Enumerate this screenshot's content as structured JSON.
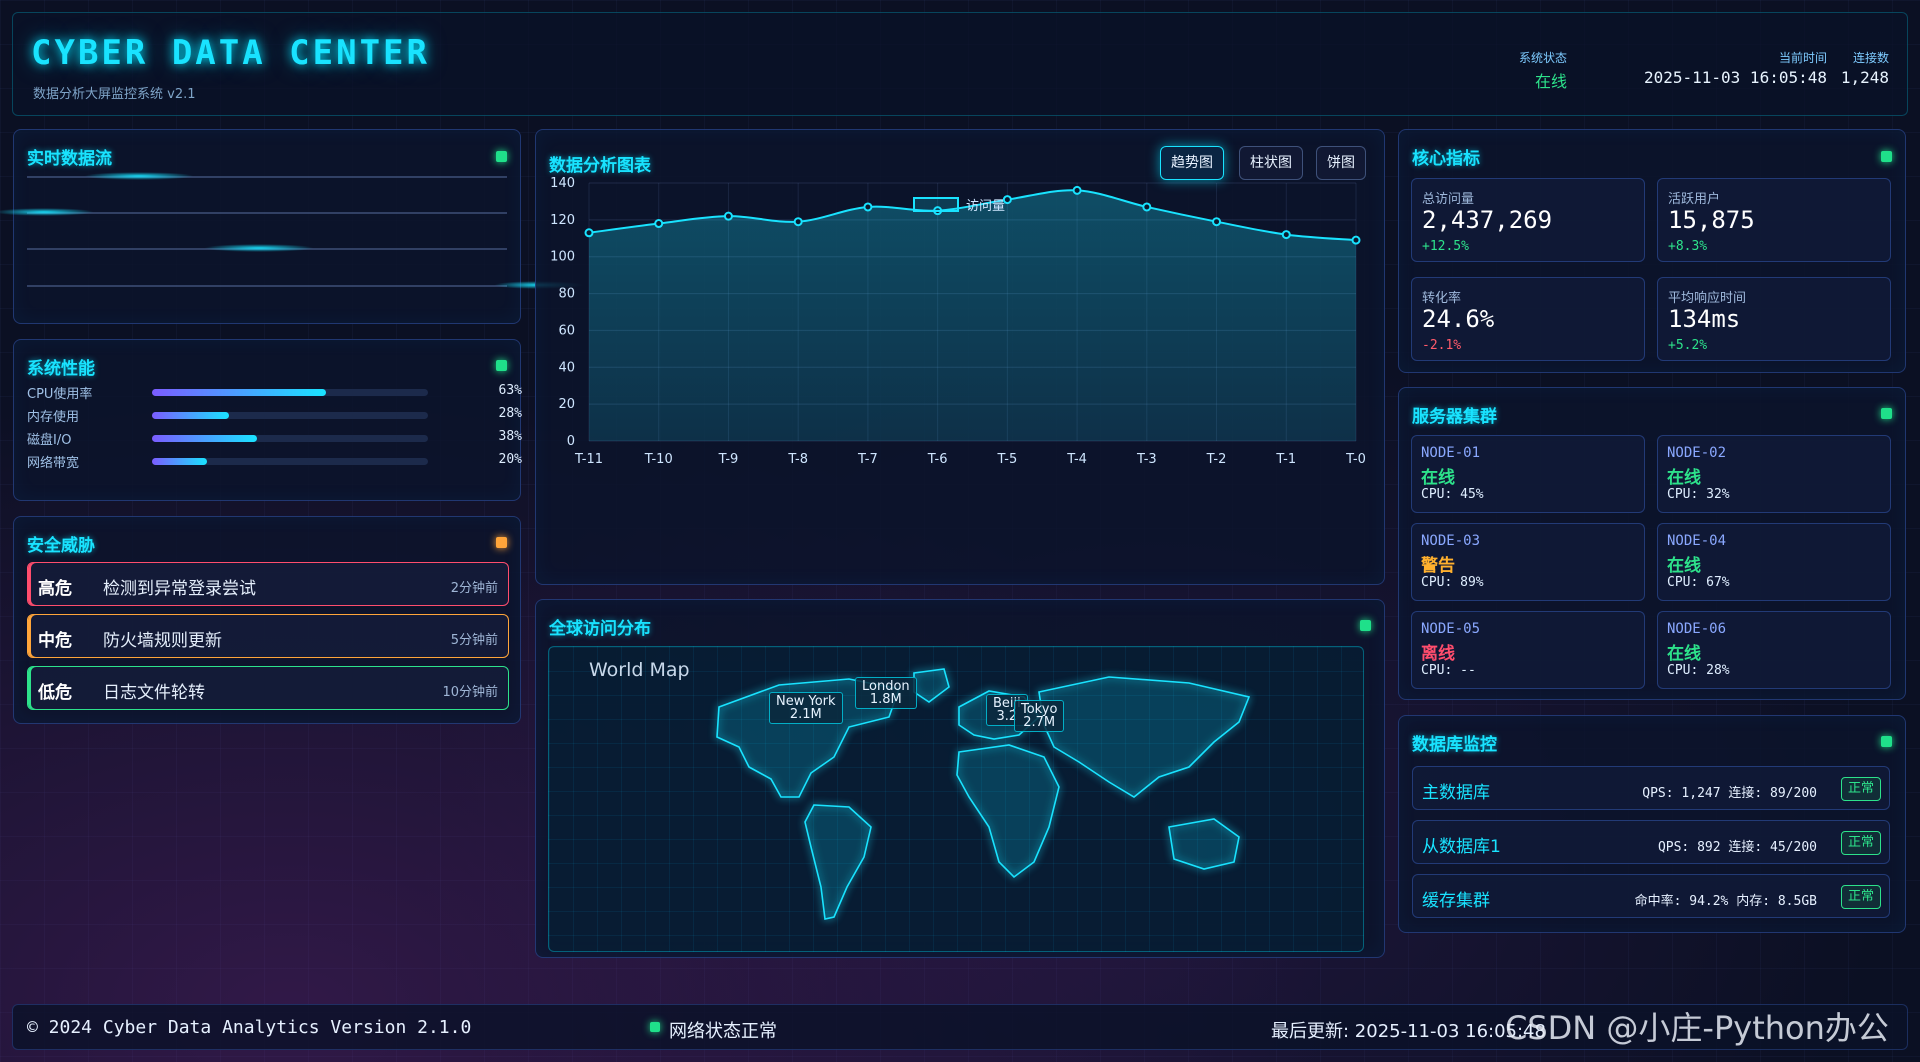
{
  "header": {
    "title": "CYBER DATA CENTER",
    "subtitle": "数据分析大屏监控系统 v2.1",
    "status_label": "系统状态",
    "status_value": "在线",
    "time_label": "当前时间",
    "time_value": "2025-11-03 16:05:48",
    "conn_label": "连接数",
    "conn_value": "1,248"
  },
  "realtime": {
    "title": "实时数据流"
  },
  "performance": {
    "title": "系统性能",
    "items": [
      {
        "label": "CPU使用率",
        "pct_text": "63%",
        "value": 63
      },
      {
        "label": "内存使用",
        "pct_text": "28%",
        "value": 28
      },
      {
        "label": "磁盘I/O",
        "pct_text": "38%",
        "value": 38
      },
      {
        "label": "网络带宽",
        "pct_text": "20%",
        "value": 20
      }
    ]
  },
  "threats": {
    "title": "安全威胁",
    "items": [
      {
        "level": "高危",
        "message": "检测到异常登录尝试",
        "time": "2分钟前",
        "color": "#ff4d6d"
      },
      {
        "level": "中危",
        "message": "防火墙规则更新",
        "time": "5分钟前",
        "color": "#ffa53a"
      },
      {
        "level": "低危",
        "message": "日志文件轮转",
        "time": "10分钟前",
        "color": "#2de28b"
      }
    ]
  },
  "chart_panel": {
    "title": "数据分析图表",
    "tabs": [
      "趋势图",
      "柱状图",
      "饼图"
    ],
    "active_tab": 0
  },
  "chart_data": {
    "type": "area",
    "categories": [
      "T-11",
      "T-10",
      "T-9",
      "T-8",
      "T-7",
      "T-6",
      "T-5",
      "T-4",
      "T-3",
      "T-2",
      "T-1",
      "T-0"
    ],
    "series": [
      {
        "name": "访问量",
        "values": [
          113,
          118,
          122,
          119,
          127,
          125,
          131,
          136,
          127,
          119,
          112,
          109
        ],
        "color": "#19e3ff"
      }
    ],
    "yticks": [
      0,
      20,
      40,
      60,
      80,
      100,
      120,
      140
    ],
    "ylim": [
      0,
      140
    ],
    "grid": true,
    "legend": "top-center"
  },
  "map_panel": {
    "title": "全球访问分布",
    "alt_text": "World Map",
    "cities": [
      {
        "name": "New York",
        "value": "2.1M"
      },
      {
        "name": "London",
        "value": "1.8M"
      },
      {
        "name": "Beiji",
        "value": "3.2"
      },
      {
        "name": "Tokyo",
        "value": "2.7M"
      }
    ]
  },
  "kpi": {
    "title": "核心指标",
    "items": [
      {
        "label": "总访问量",
        "value": "2,437,269",
        "change": "+12.5%",
        "dir": "up"
      },
      {
        "label": "活跃用户",
        "value": "15,875",
        "change": "+8.3%",
        "dir": "up"
      },
      {
        "label": "转化率",
        "value": "24.6%",
        "change": "-2.1%",
        "dir": "down"
      },
      {
        "label": "平均响应时间",
        "value": "134ms",
        "change": "+5.2%",
        "dir": "up"
      }
    ]
  },
  "cluster": {
    "title": "服务器集群",
    "nodes": [
      {
        "id": "NODE-01",
        "status": "在线",
        "state": "on",
        "cpu": "CPU: 45%"
      },
      {
        "id": "NODE-02",
        "status": "在线",
        "state": "on",
        "cpu": "CPU: 32%"
      },
      {
        "id": "NODE-03",
        "status": "警告",
        "state": "warn",
        "cpu": "CPU: 89%"
      },
      {
        "id": "NODE-04",
        "status": "在线",
        "state": "on",
        "cpu": "CPU: 67%"
      },
      {
        "id": "NODE-05",
        "status": "离线",
        "state": "off",
        "cpu": "CPU: --"
      },
      {
        "id": "NODE-06",
        "status": "在线",
        "state": "on",
        "cpu": "CPU: 28%"
      }
    ]
  },
  "database": {
    "title": "数据库监控",
    "items": [
      {
        "name": "主数据库",
        "metrics": "QPS: 1,247  连接: 89/200",
        "status": "正常"
      },
      {
        "name": "从数据库1",
        "metrics": "QPS: 892  连接: 45/200",
        "status": "正常"
      },
      {
        "name": "缓存集群",
        "metrics": "命中率: 94.2%  内存: 8.5GB",
        "status": "正常"
      }
    ]
  },
  "footer": {
    "copyright": "© 2024 Cyber Data Analytics  Version 2.1.0",
    "network": "网络状态正常",
    "last_update": "最后更新: 2025-11-03 16:05:48"
  },
  "watermark": "CSDN @小庄-Python办公"
}
